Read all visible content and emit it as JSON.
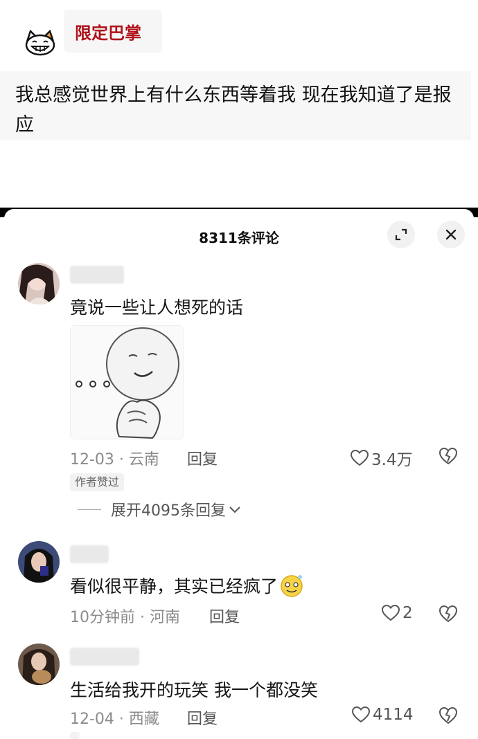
{
  "post": {
    "author": "限定巴掌",
    "text": "我总感觉世界上有什么东西等着我  现在我知道了是报应"
  },
  "comments_panel": {
    "title": "8311条评论",
    "expand_icon": "expand-icon",
    "close_icon": "close-icon"
  },
  "comments": [
    {
      "text": "竟说一些让人想死的话",
      "date": "12-03 · 云南",
      "reply_label": "回复",
      "likes": "3.4万",
      "badge": "作者赞过",
      "expand_label": "展开4095条回复"
    },
    {
      "text": "看似很平静，其实已经疯了",
      "date": "10分钟前 · 河南",
      "reply_label": "回复",
      "likes": "2"
    },
    {
      "text": "生活给我开的玩笑 我一个都没笑",
      "date": "12-04 · 西藏",
      "reply_label": "回复",
      "likes": "4114"
    }
  ],
  "colors": {
    "author_red": "#b0121b",
    "meta_gray": "#8b8b8b"
  }
}
